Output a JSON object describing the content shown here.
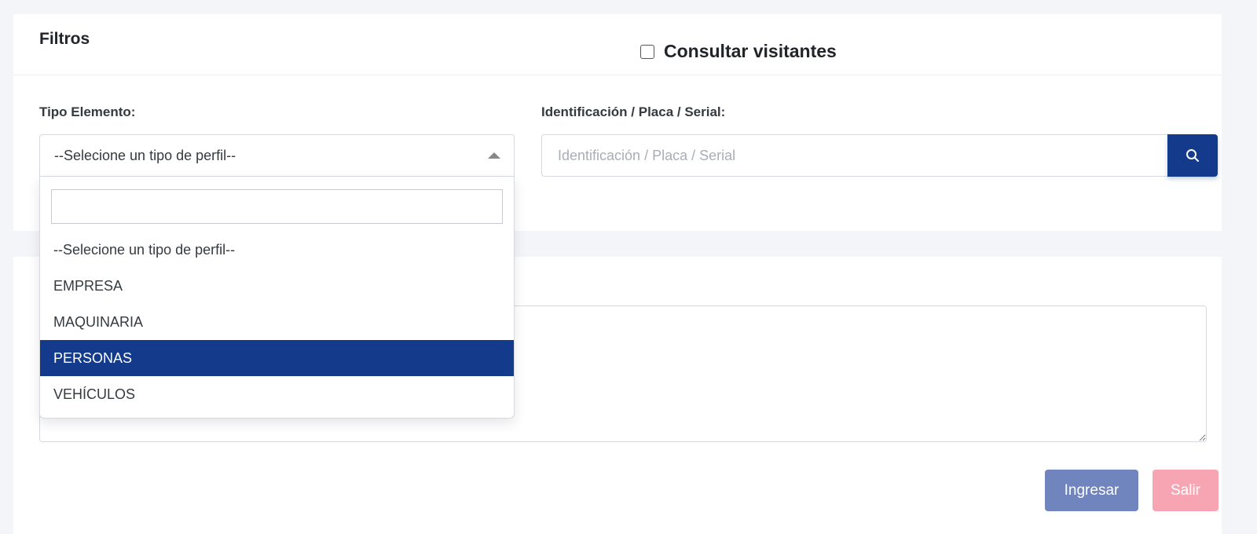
{
  "filters": {
    "title": "Filtros",
    "visitors_checkbox_label": "Consultar visitantes",
    "tipo_label": "Tipo Elemento:",
    "tipo_selected": "--Selecione un tipo de perfil--",
    "ident_label": "Identificación / Placa / Serial:",
    "ident_placeholder": "Identificación / Placa / Serial"
  },
  "dropdown": {
    "search_value": "",
    "options": [
      "--Selecione un tipo de perfil--",
      "EMPRESA",
      "MAQUINARIA",
      "PERSONAS",
      "VEHÍCULOS"
    ],
    "highlighted": "PERSONAS"
  },
  "actions": {
    "ingresar_label": "Ingresar",
    "salir_label": "Salir"
  },
  "colors": {
    "primary": "#143a8c",
    "ingresar_bg": "#7084bd",
    "salir_bg": "#f8a5b3"
  }
}
